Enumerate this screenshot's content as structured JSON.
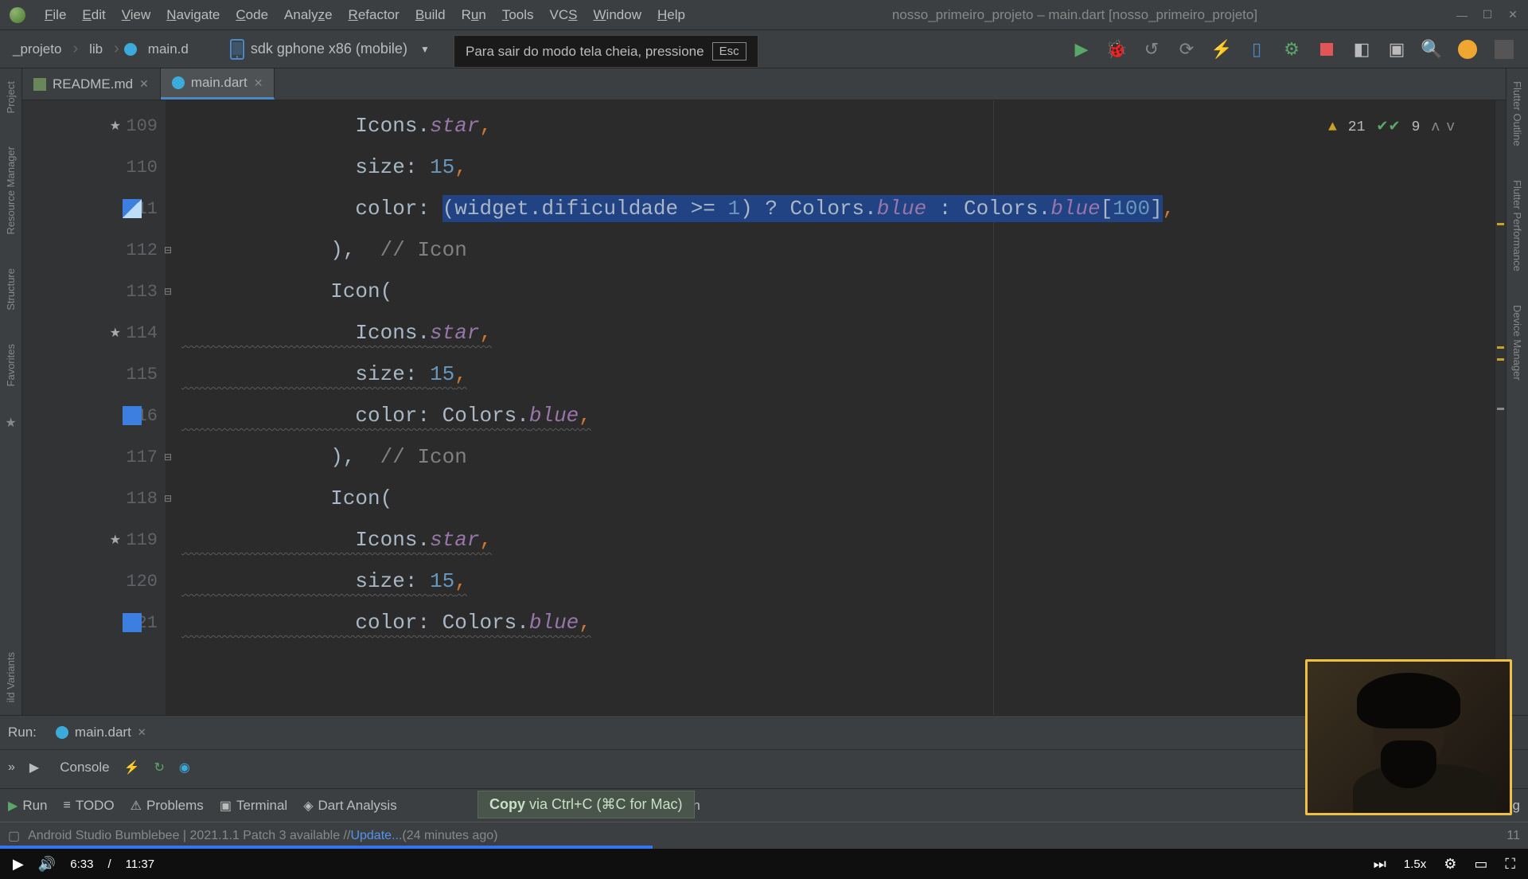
{
  "window": {
    "title": "nosso_primeiro_projeto – main.dart [nosso_primeiro_projeto]"
  },
  "menu": {
    "file": "File",
    "edit": "Edit",
    "view": "View",
    "navigate": "Navigate",
    "code": "Code",
    "analyze": "Analyze",
    "refactor": "Refactor",
    "build": "Build",
    "run": "Run",
    "tools": "Tools",
    "vcs": "VCS",
    "window": "Window",
    "help": "Help"
  },
  "breadcrumb": {
    "root": "_projeto",
    "lib": "lib",
    "file": "main.d"
  },
  "device": "sdk gphone x86 (mobile)",
  "fullscreen_hint": {
    "text": "Para sair do modo tela cheia, pressione",
    "key": "Esc"
  },
  "tabs": {
    "readme": "README.md",
    "main": "main.dart"
  },
  "gutter": {
    "109": "109",
    "110": "110",
    "111": "111",
    "112": "112",
    "113": "113",
    "114": "114",
    "115": "115",
    "116": "116",
    "117": "117",
    "118": "118",
    "119": "119",
    "120": "120",
    "121": "121"
  },
  "code": {
    "l109a": "              Icons.",
    "l109b": "star",
    "l109c": ",",
    "l110a": "              size: ",
    "l110b": "15",
    "l110c": ",",
    "l111a": "              color: ",
    "l111sel": "(widget.dificuldade >= 1) ? Colors.blue : Colors.blue[100]",
    "l111c": ",",
    "l112a": "            ),  ",
    "l112b": "// Icon",
    "l113a": "            Icon(",
    "l114a": "              Icons.",
    "l114b": "star",
    "l114c": ",",
    "l115a": "              size: ",
    "l115b": "15",
    "l115c": ",",
    "l116a": "              color: Colors.",
    "l116b": "blue",
    "l116c": ",",
    "l117a": "            ),  ",
    "l117b": "// Icon",
    "l118a": "            Icon(",
    "l119a": "              Icons.",
    "l119b": "star",
    "l119c": ",",
    "l120a": "              size: ",
    "l120b": "15",
    "l120c": ",",
    "l121a": "              color: Colors.",
    "l121b": "blue",
    "l121c": ","
  },
  "inspections": {
    "warnings": "21",
    "passes": "9"
  },
  "left_rail": {
    "project": "Project",
    "resmgr": "Resource Manager",
    "structure": "Structure",
    "favorites": "Favorites",
    "variants": "ild Variants"
  },
  "right_rail": {
    "outline": "Flutter Outline",
    "perf": "Flutter Performance",
    "devmgr": "Device Manager"
  },
  "run": {
    "label": "Run:",
    "target": "main.dart",
    "console": "Console",
    "expand": "»"
  },
  "bottom": {
    "run": "Run",
    "todo": "TODO",
    "problems": "Problems",
    "terminal": "Terminal",
    "dart": "Dart Analysis",
    "appinsp": "pp Inspection",
    "eventlog": "Event Log"
  },
  "copy_toast": {
    "strong": "Copy",
    "rest": " via Ctrl+C (⌘C for Mac)"
  },
  "status": {
    "text": "Android Studio Bumblebee | 2021.1.1 Patch 3 available // ",
    "update": "Update...",
    "ago": " (24 minutes ago)",
    "pos": "11"
  },
  "video": {
    "current": "6:33",
    "sep": "/",
    "total": "11:37",
    "speed": "1.5x"
  },
  "colors": {
    "blue_swatch": "#3d7fe0",
    "blue_light": "#64a3ff"
  }
}
